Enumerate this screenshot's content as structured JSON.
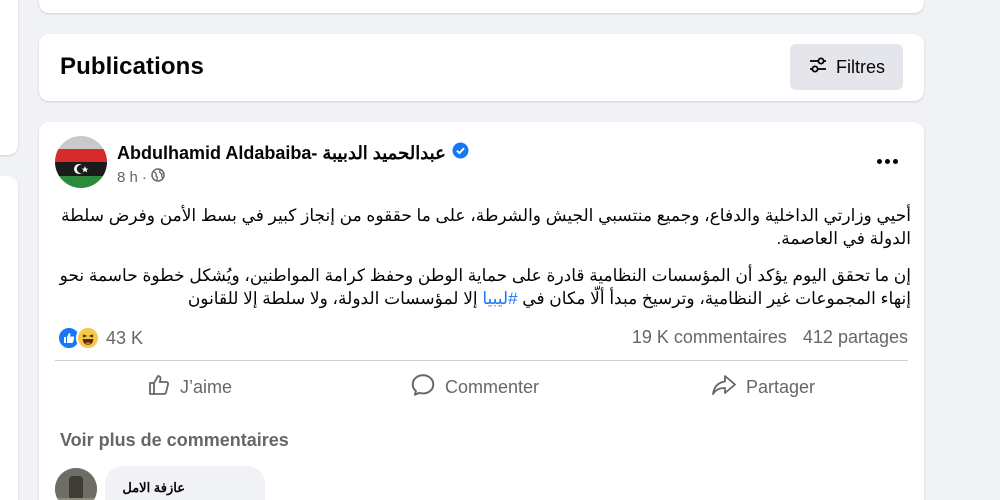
{
  "publications": {
    "title": "Publications",
    "filter_label": "Filtres"
  },
  "post": {
    "author": "Abdulhamid Aldabaiba- عبدالحميد الدبيبة",
    "time": "8 h",
    "paragraphs": [
      {
        "text": "أحيي وزارتي الداخلية والدفاع، وجميع منتسبي الجيش والشرطة، على ما حققوه من إنجاز كبير في بسط الأمن وفرض سلطة الدولة في العاصمة."
      },
      {
        "before": "إن ما تحقق اليوم يؤكد أن المؤسسات النظامية قادرة على حماية الوطن وحفظ كرامة المواطنين، ويُشكل خطوة حاسمة نحو إنهاء المجموعات غير النظامية، وترسيخ مبدأ ألّا مكان في ",
        "hashtag": "#ليبيا",
        "after": " إلا لمؤسسات الدولة، ولا سلطة إلا للقانون"
      }
    ],
    "reaction_count": "43 K",
    "comments_count": "19 K commentaires",
    "shares_count": "412 partages",
    "actions": {
      "like": "J’aime",
      "comment": "Commenter",
      "share": "Partager"
    },
    "more_comments": "Voir plus de commentaires",
    "first_comment_author": "عازفة الامل"
  },
  "colors": {
    "accent": "#1877f2",
    "secondary_text": "#65676b",
    "background": "#f0f2f5"
  }
}
